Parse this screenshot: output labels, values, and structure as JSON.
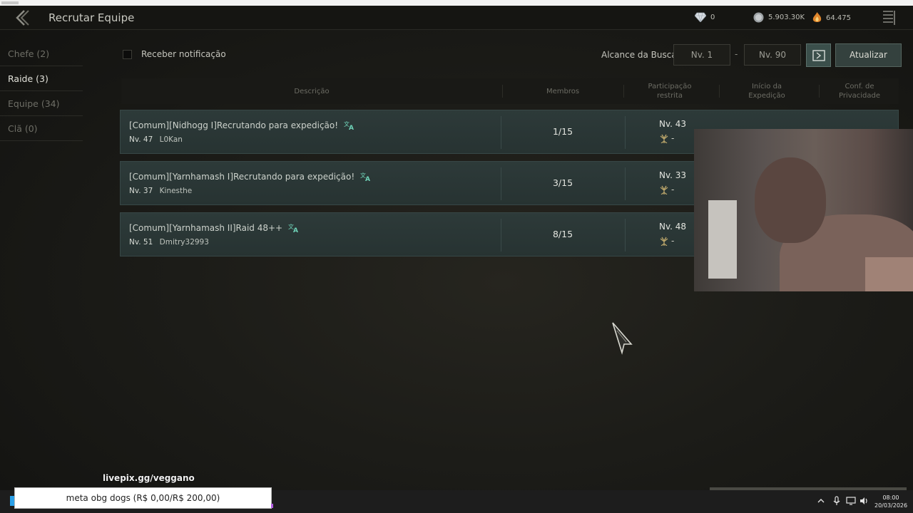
{
  "header": {
    "title": "Recrutar Equipe",
    "currencies": {
      "diamond": "0",
      "silver": "5.903.30K",
      "energy": "64.475"
    }
  },
  "nav": [
    {
      "label": "Chefe (2)"
    },
    {
      "label": "Raide (3)"
    },
    {
      "label": "Equipe (34)"
    },
    {
      "label": "Clã (0)"
    }
  ],
  "active_nav_index": 1,
  "filters": {
    "notify_label": "Receber notificação",
    "notify_checked": false,
    "range_label": "Alcance da Busca",
    "level_min": "Nv. 1",
    "range_separator": "-",
    "level_max": "Nv. 90",
    "refresh_label": "Atualizar"
  },
  "table": {
    "headers": {
      "description": "Descrição",
      "members": "Membros",
      "restricted": "Participação restrita",
      "start": "Início da Expedição",
      "privacy": "Conf. de Privacidade"
    },
    "rows": [
      {
        "desc": "[Comum][Nidhogg I]Recrutando para expedição!",
        "leader_lv": "Nv. 47",
        "leader": "L0Kan",
        "members": "1/15",
        "req_lv": "Nv. 43",
        "req_extra": "-"
      },
      {
        "desc": "[Comum][Yarnhamash I]Recrutando para expedição!",
        "leader_lv": "Nv. 37",
        "leader": "Kinesthe",
        "members": "3/15",
        "req_lv": "Nv. 33",
        "req_extra": "-"
      },
      {
        "desc": "[Comum][Yarnhamash II]Raid 48++",
        "leader_lv": "Nv. 51",
        "leader": "Dmitry32993",
        "members": "8/15",
        "req_lv": "Nv. 48",
        "req_extra": "-"
      }
    ]
  },
  "overlay": {
    "livepix": "livepix.gg/veggano",
    "goal": "meta obg dogs (R$ 0,00/R$ 200,00)"
  },
  "taskbar": {
    "time": "08:00",
    "date": "20/03/2026"
  },
  "colors": {
    "row_bg": "#2d3a39",
    "accent_teal": "#6fd3b8",
    "gold_icon": "#b9a46a"
  }
}
